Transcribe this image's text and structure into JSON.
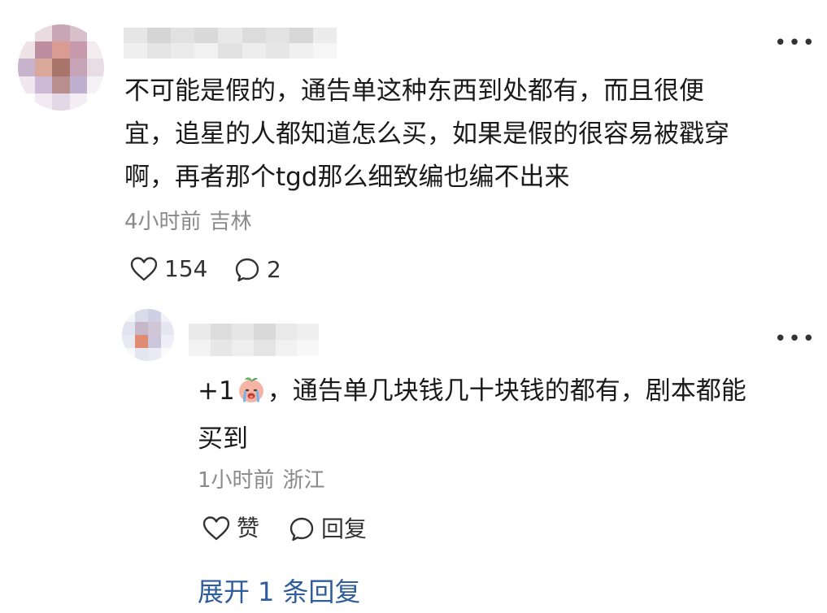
{
  "colors": {
    "link": "#2f5d9c",
    "meta": "#8a8a8a",
    "text": "#1a1a1a"
  },
  "main_comment": {
    "text_lines": [
      "不可能是假的，通告单这种东西到处都有，而且很便",
      "宜，追星的人都知道怎么买，如果是假的很容易被戳穿",
      "啊，再者那个tgd那么细致编也编不出来"
    ],
    "time": "4小时前",
    "location": "吉林",
    "like_count": "154",
    "reply_count": "2",
    "more_icon": "ellipsis-icon"
  },
  "reply_comment": {
    "text_prefix": "+1",
    "emoji": "crying-peach-emoji",
    "text_line1_rest": "，通告单几块钱几十块钱的都有，剧本都能",
    "text_line2": "买到",
    "time": "1小时前",
    "location": "浙江",
    "like_label": "赞",
    "reply_label": "回复",
    "more_icon": "ellipsis-icon"
  },
  "expand": {
    "prefix": "展开",
    "count": "1",
    "suffix": "条回复"
  }
}
